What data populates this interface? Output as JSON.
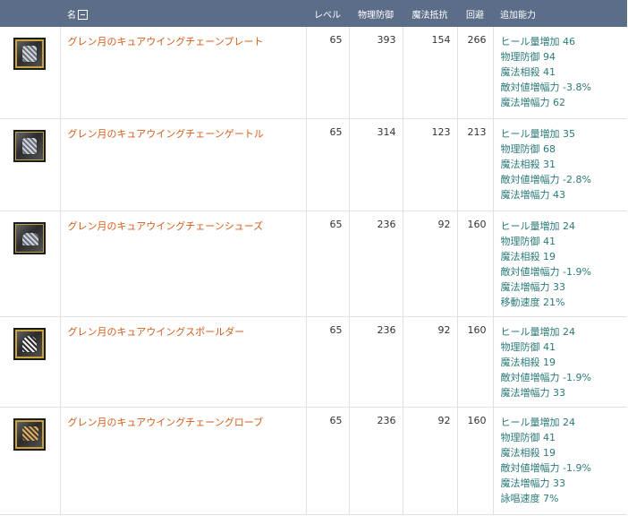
{
  "header": {
    "name": "名",
    "level": "レベル",
    "phys_def": "物理防御",
    "mag_res": "魔法抵抗",
    "evasion": "回避",
    "bonus": "追加能力"
  },
  "items": [
    {
      "icon": "chain-plate-armor-icon",
      "name": "グレン月のキュアウイングチェーンプレート",
      "level": "65",
      "phys_def": "393",
      "mag_res": "154",
      "evasion": "266",
      "bonus": [
        "ヒール量増加 46",
        "物理防御 94",
        "魔法相殺 41",
        "敵対値増幅力 -3.8%",
        "魔法増幅力 62"
      ]
    },
    {
      "icon": "chain-gaiter-icon",
      "name": "グレン月のキュアウイングチェーンゲートル",
      "level": "65",
      "phys_def": "314",
      "mag_res": "123",
      "evasion": "213",
      "bonus": [
        "ヒール量増加 35",
        "物理防御 68",
        "魔法相殺 31",
        "敵対値増幅力 -2.8%",
        "魔法増幅力 43"
      ]
    },
    {
      "icon": "chain-shoes-icon",
      "name": "グレン月のキュアウイングチェーンシューズ",
      "level": "65",
      "phys_def": "236",
      "mag_res": "92",
      "evasion": "160",
      "bonus": [
        "ヒール量増加 24",
        "物理防御 41",
        "魔法相殺 19",
        "敵対値増幅力 -1.9%",
        "魔法増幅力 33",
        "移動速度 21%"
      ]
    },
    {
      "icon": "shoulder-guard-icon",
      "name": "グレン月のキュアウイングスポールダー",
      "level": "65",
      "phys_def": "236",
      "mag_res": "92",
      "evasion": "160",
      "bonus": [
        "ヒール量増加 24",
        "物理防御 41",
        "魔法相殺 19",
        "敵対値増幅力 -1.9%",
        "魔法増幅力 33"
      ]
    },
    {
      "icon": "chain-glove-icon",
      "name": "グレン月のキュアウイングチェーングローブ",
      "level": "65",
      "phys_def": "236",
      "mag_res": "92",
      "evasion": "160",
      "bonus": [
        "ヒール量増加 24",
        "物理防御 41",
        "魔法相殺 19",
        "敵対値増幅力 -1.9%",
        "魔法増幅力 33",
        "詠唱速度 7%"
      ]
    }
  ]
}
